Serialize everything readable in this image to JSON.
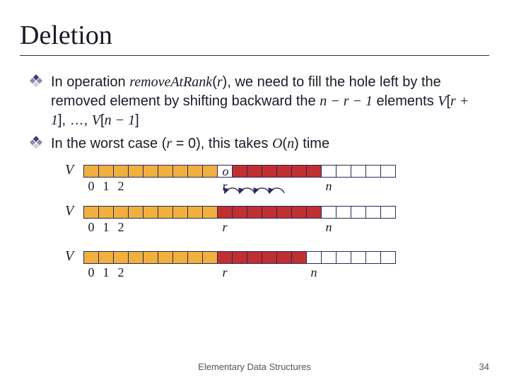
{
  "title": "Deletion",
  "bullets": {
    "b1_pre": "In operation ",
    "b1_method": "removeAtRank",
    "b1_paren_open": "(",
    "b1_r": "r",
    "b1_paren_close": ")",
    "b1_mid": ", we need to fill the hole left by the removed element by shifting backward the ",
    "b1_expr": "n − r − 1",
    "b1_elements": " elements ",
    "b1_v1": "V",
    "b1_br1o": "[",
    "b1_rp1": "r + 1",
    "b1_br1c": "], …, ",
    "b1_v2": "V",
    "b1_br2o": "[",
    "b1_nm1": "n − 1",
    "b1_br2c": "]",
    "b2_pre": "In the worst case (",
    "b2_r": "r",
    "b2_eq": " = 0",
    "b2_mid": "), this takes ",
    "b2_O": "O",
    "b2_po": "(",
    "b2_n": "n",
    "b2_pc": ")",
    "b2_post": " time"
  },
  "diagram": {
    "V": "V",
    "hole_o": "o",
    "idx0": "0",
    "idx1": "1",
    "idx2": "2",
    "r": "r",
    "n": "n"
  },
  "footer": "Elementary Data Structures",
  "pagenum": "34"
}
